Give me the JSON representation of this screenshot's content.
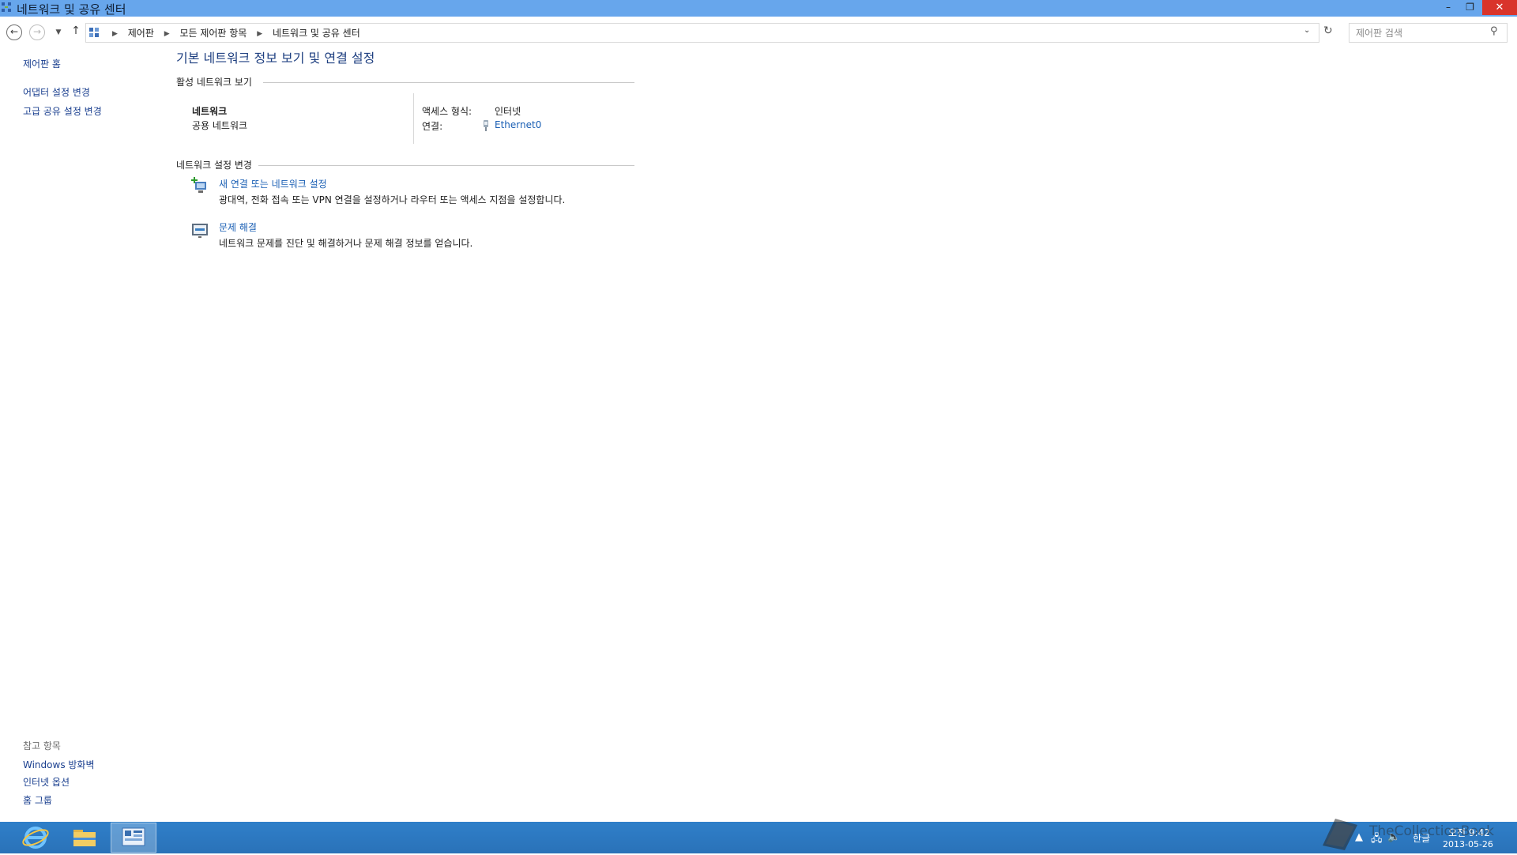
{
  "window": {
    "title": "네트워크 및 공유 센터",
    "min_glyph": "–",
    "max_glyph": "❐",
    "close_glyph": "✕"
  },
  "address": {
    "crumbs": [
      "제어판",
      "모든 제어판 항목",
      "네트워크 및 공유 센터"
    ],
    "search_placeholder": "제어판 검색"
  },
  "leftnav": {
    "home": "제어판 홈",
    "adapter": "어댑터 설정 변경",
    "advanced_sharing": "고급 공유 설정 변경",
    "see_also_header": "참고 항목",
    "see_also": [
      "Windows 방화벽",
      "인터넷 옵션",
      "홈 그룹"
    ]
  },
  "main": {
    "title": "기본 네트워크 정보 보기 및 연결 설정",
    "active_networks_header": "활성 네트워크 보기",
    "network_name": "네트워크",
    "network_type": "공용 네트워크",
    "access_type_label": "액세스 형식:",
    "access_type_value": "인터넷",
    "connection_label": "연결:",
    "connection_value": "Ethernet0",
    "change_settings_header": "네트워크 설정 변경",
    "tasks": [
      {
        "title": "새 연결 또는 네트워크 설정",
        "desc": "광대역, 전화 접속 또는 VPN 연결을 설정하거나 라우터 또는 액세스 지점을 설정합니다."
      },
      {
        "title": "문제 해결",
        "desc": "네트워크 문제를 진단 및 해결하거나 문제 해결 정보를 얻습니다."
      }
    ]
  },
  "taskbar": {
    "ime": "한글",
    "time": "오전 9:42",
    "date": "2013-05-26",
    "watermark": "TheCollectionBook"
  },
  "colors": {
    "titlebar": "#67a6ec",
    "link": "#1a5fb4",
    "taskbar": "#2f7fc9",
    "close": "#d9342b"
  }
}
